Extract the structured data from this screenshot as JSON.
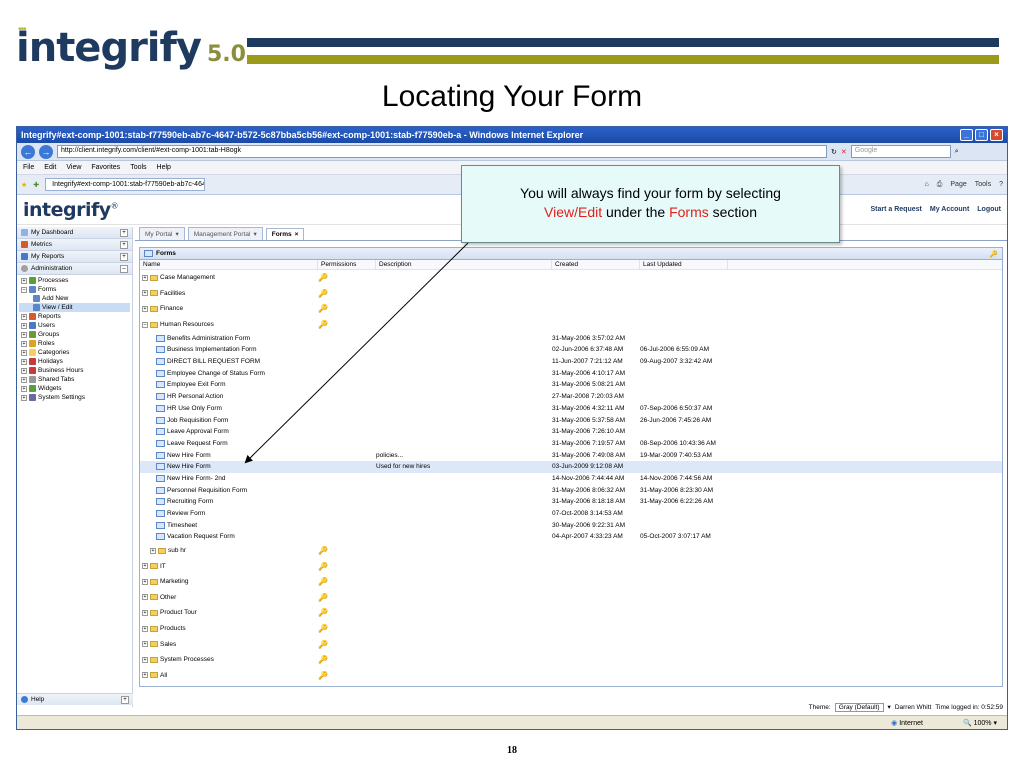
{
  "slide": {
    "logo_word": "integrify",
    "logo_version": "5.0",
    "title": "Locating Your Form",
    "page_number": "18",
    "colors": {
      "navy": "#1e3a5f",
      "olive": "#9a9b1b",
      "callout_bg": "#e6fafa",
      "highlight_red": "#e0201b"
    }
  },
  "browser": {
    "window_title": "Integrify#ext-comp-1001:stab-f77590eb-ab7c-4647-b572-5c87bba5cb56#ext-comp-1001:stab-f77590eb-a - Windows Internet Explorer",
    "address": "http://client.integrify.com/client/#ext-comp-1001:tab-H8ogk",
    "search_placeholder": "Google",
    "menu": [
      "File",
      "Edit",
      "View",
      "Favorites",
      "Tools",
      "Help"
    ],
    "tab_title": "Integrify#ext-comp-1001:stab-f77590eb-ab7c-4647-...",
    "tab_tools": [
      "Page",
      "Tools"
    ],
    "status_zone": "Internet",
    "zoom": "100%"
  },
  "app": {
    "logo": "integrify",
    "header_links": [
      "Start a Request",
      "My Account",
      "Logout"
    ],
    "nav_sections": [
      "My Dashboard",
      "Metrics",
      "My Reports",
      "Administration"
    ],
    "nav_tree": [
      {
        "label": "Processes",
        "level": 0,
        "icon": "processes-icon"
      },
      {
        "label": "Forms",
        "level": 0,
        "icon": "forms-icon"
      },
      {
        "label": "Add New",
        "level": 1,
        "icon": "add-new-icon"
      },
      {
        "label": "View / Edit",
        "level": 1,
        "icon": "view-edit-icon"
      },
      {
        "label": "Reports",
        "level": 0,
        "icon": "reports-icon"
      },
      {
        "label": "Users",
        "level": 0,
        "icon": "users-icon"
      },
      {
        "label": "Groups",
        "level": 0,
        "icon": "groups-icon"
      },
      {
        "label": "Roles",
        "level": 0,
        "icon": "roles-icon"
      },
      {
        "label": "Categories",
        "level": 0,
        "icon": "categories-icon"
      },
      {
        "label": "Holidays",
        "level": 0,
        "icon": "holidays-icon"
      },
      {
        "label": "Business Hours",
        "level": 0,
        "icon": "business-hours-icon"
      },
      {
        "label": "Shared Tabs",
        "level": 0,
        "icon": "shared-tabs-icon"
      },
      {
        "label": "Widgets",
        "level": 0,
        "icon": "widgets-icon"
      },
      {
        "label": "System Settings",
        "level": 0,
        "icon": "system-settings-icon"
      }
    ],
    "help_label": "Help",
    "portal_tabs": [
      "My Portal",
      "Management Portal",
      "Forms"
    ],
    "panel_title": "Forms",
    "columns": [
      "Name",
      "Permissions",
      "Description",
      "Created",
      "Last Updated"
    ],
    "rows": [
      {
        "name": "Case Management",
        "type": "folder",
        "perm": true,
        "desc": "",
        "created": "",
        "updated": ""
      },
      {
        "name": "Facilities",
        "type": "folder",
        "perm": true,
        "desc": "",
        "created": "",
        "updated": ""
      },
      {
        "name": "Finance",
        "type": "folder",
        "perm": true,
        "desc": "",
        "created": "",
        "updated": ""
      },
      {
        "name": "Human Resources",
        "type": "folder-open",
        "perm": true,
        "desc": "",
        "created": "",
        "updated": ""
      },
      {
        "name": "Benefits Administration Form",
        "type": "form",
        "perm": false,
        "desc": "",
        "created": "31-May-2006 3:57:02 AM",
        "updated": ""
      },
      {
        "name": "Business Implementation Form",
        "type": "form",
        "perm": false,
        "desc": "",
        "created": "02-Jun-2006 6:37:48 AM",
        "updated": "06-Jul-2006 6:55:09 AM"
      },
      {
        "name": "DIRECT BILL REQUEST FORM",
        "type": "form",
        "perm": false,
        "desc": "",
        "created": "11-Jun-2007 7:21:12 AM",
        "updated": "09-Aug-2007 3:32:42 AM"
      },
      {
        "name": "Employee Change of Status Form",
        "type": "form",
        "perm": false,
        "desc": "",
        "created": "31-May-2006 4:10:17 AM",
        "updated": ""
      },
      {
        "name": "Employee Exit Form",
        "type": "form",
        "perm": false,
        "desc": "",
        "created": "31-May-2006 5:08:21 AM",
        "updated": ""
      },
      {
        "name": "HR Personal Action",
        "type": "form",
        "perm": false,
        "desc": "",
        "created": "27-Mar-2008 7:20:03 AM",
        "updated": ""
      },
      {
        "name": "HR Use Only Form",
        "type": "form",
        "perm": false,
        "desc": "",
        "created": "31-May-2006 4:32:11 AM",
        "updated": "07-Sep-2006 6:50:37 AM"
      },
      {
        "name": "Job Requisition Form",
        "type": "form",
        "perm": false,
        "desc": "",
        "created": "31-May-2006 5:37:58 AM",
        "updated": "26-Jun-2006 7:45:26 AM"
      },
      {
        "name": "Leave Approval Form",
        "type": "form",
        "perm": false,
        "desc": "",
        "created": "31-May-2006 7:26:10 AM",
        "updated": ""
      },
      {
        "name": "Leave Request Form",
        "type": "form",
        "perm": false,
        "desc": "",
        "created": "31-May-2006 7:19:57 AM",
        "updated": "08-Sep-2006 10:43:36 AM"
      },
      {
        "name": "New Hire Form",
        "type": "form",
        "perm": false,
        "desc": "policies...",
        "created": "31-May-2006 7:49:08 AM",
        "updated": "19-Mar-2009 7:40:53 AM"
      },
      {
        "name": "New Hire Form",
        "type": "form",
        "perm": false,
        "desc": "Used for new hires",
        "created": "03-Jun-2009 9:12:08 AM",
        "updated": "",
        "highlight": true
      },
      {
        "name": "New Hire Form- 2nd",
        "type": "form",
        "perm": false,
        "desc": "",
        "created": "14-Nov-2006 7:44:44 AM",
        "updated": "14-Nov-2006 7:44:56 AM"
      },
      {
        "name": "Personnel Requisition Form",
        "type": "form",
        "perm": false,
        "desc": "",
        "created": "31-May-2006 8:06:32 AM",
        "updated": "31-May-2006 8:23:30 AM"
      },
      {
        "name": "Recruiting Form",
        "type": "form",
        "perm": false,
        "desc": "",
        "created": "31-May-2006 8:18:18 AM",
        "updated": "31-May-2006 6:22:26 AM"
      },
      {
        "name": "Review Form",
        "type": "form",
        "perm": false,
        "desc": "",
        "created": "07-Oct-2008 3:14:53 AM",
        "updated": ""
      },
      {
        "name": "Timesheet",
        "type": "form",
        "perm": false,
        "desc": "",
        "created": "30-May-2006 9:22:31 AM",
        "updated": ""
      },
      {
        "name": "Vacation Request Form",
        "type": "form",
        "perm": false,
        "desc": "",
        "created": "04-Apr-2007 4:33:23 AM",
        "updated": "05-Oct-2007 3:07:17 AM"
      },
      {
        "name": "sub hr",
        "type": "subfolder",
        "perm": true,
        "desc": "",
        "created": "",
        "updated": ""
      },
      {
        "name": "IT",
        "type": "folder",
        "perm": true,
        "desc": "",
        "created": "",
        "updated": ""
      },
      {
        "name": "Marketing",
        "type": "folder",
        "perm": true,
        "desc": "",
        "created": "",
        "updated": ""
      },
      {
        "name": "Other",
        "type": "folder",
        "perm": true,
        "desc": "",
        "created": "",
        "updated": ""
      },
      {
        "name": "Product Tour",
        "type": "folder",
        "perm": true,
        "desc": "",
        "created": "",
        "updated": ""
      },
      {
        "name": "Products",
        "type": "folder",
        "perm": true,
        "desc": "",
        "created": "",
        "updated": ""
      },
      {
        "name": "Sales",
        "type": "folder",
        "perm": true,
        "desc": "",
        "created": "",
        "updated": ""
      },
      {
        "name": "System Processes",
        "type": "folder",
        "perm": true,
        "desc": "",
        "created": "",
        "updated": ""
      },
      {
        "name": "All",
        "type": "folder",
        "perm": true,
        "desc": "",
        "created": "",
        "updated": ""
      }
    ],
    "theme_label": "Theme:",
    "theme_value": "Gray (Default)",
    "user": "Darren Whitt",
    "time_logged": "Time logged in: 0:52:59"
  },
  "callout": {
    "line1": "You will always find your form by selecting",
    "view_edit": "View/Edit",
    "mid": "under the",
    "forms": "Forms",
    "end": "section"
  }
}
